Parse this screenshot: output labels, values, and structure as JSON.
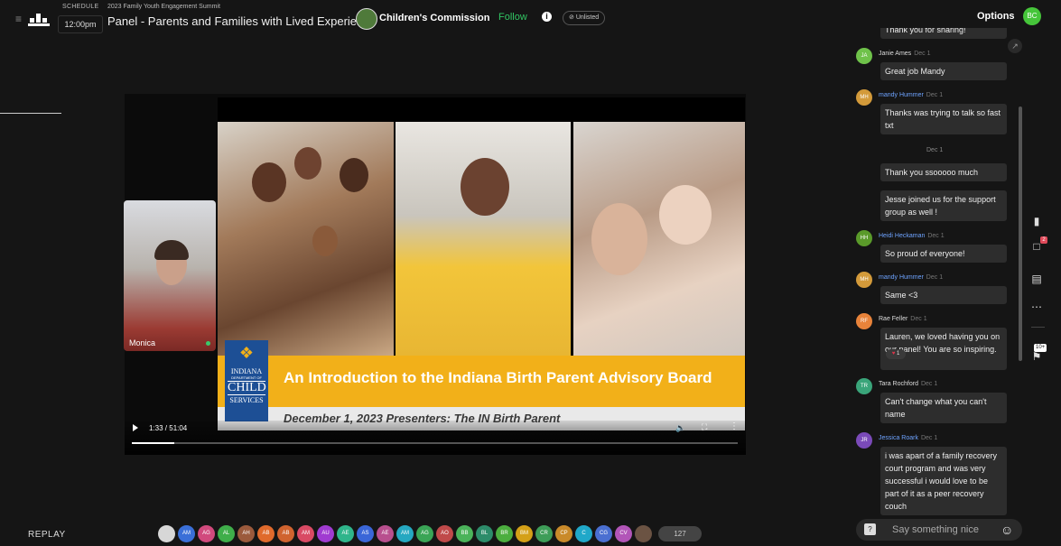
{
  "topbar": {
    "schedule_label": "SCHEDULE",
    "schedule_time": "12:00pm",
    "event_name": "2023 Family Youth Engagement Summit",
    "session_title": "Panel - Parents and Families with Lived Experience",
    "org_name": "Children's Commission",
    "follow_label": "Follow",
    "unlisted_label": "Unlisted",
    "options_label": "Options",
    "user_initials": "BC"
  },
  "slide": {
    "logo_lines": [
      "INDIANA",
      "DEPARTMENT OF",
      "CHILD",
      "SERVICES"
    ],
    "title": "An Introduction to the Indiana Birth Parent Advisory Board",
    "subtitle": "December 1, 2023 Presenters: The IN Birth Parent"
  },
  "video": {
    "time": "1:33 / 51:04",
    "progress": 0.07
  },
  "camera": {
    "name": "Monica"
  },
  "footer": {
    "replay_label": "REPLAY",
    "attendees": [
      {
        "initials": "",
        "color": "#d7d7d7"
      },
      {
        "initials": "AM",
        "color": "#3a6fd8"
      },
      {
        "initials": "AG",
        "color": "#d14a7d"
      },
      {
        "initials": "AL",
        "color": "#3fae4a"
      },
      {
        "initials": "AH",
        "color": "#9b5a3c"
      },
      {
        "initials": "AB",
        "color": "#e06a2c"
      },
      {
        "initials": "AB",
        "color": "#d0632f"
      },
      {
        "initials": "AM",
        "color": "#d94a64"
      },
      {
        "initials": "AU",
        "color": "#a03bd1"
      },
      {
        "initials": "AE",
        "color": "#2fb58b"
      },
      {
        "initials": "AS",
        "color": "#3a66d8"
      },
      {
        "initials": "AE",
        "color": "#b84f8e"
      },
      {
        "initials": "AM",
        "color": "#25a8c1"
      },
      {
        "initials": "AG",
        "color": "#3aa556"
      },
      {
        "initials": "AO",
        "color": "#c04a4a"
      },
      {
        "initials": "BB",
        "color": "#4bb35a"
      },
      {
        "initials": "BL",
        "color": "#2d8c6a"
      },
      {
        "initials": "BR",
        "color": "#4cae3f"
      },
      {
        "initials": "BM",
        "color": "#d4a017"
      },
      {
        "initials": "CR",
        "color": "#3e9d58"
      },
      {
        "initials": "CP",
        "color": "#c98a2a"
      },
      {
        "initials": "C",
        "color": "#20a8c9"
      },
      {
        "initials": "CG",
        "color": "#4a6fd1"
      },
      {
        "initials": "CV",
        "color": "#b255b8"
      },
      {
        "initials": "",
        "color": "#6b5343"
      }
    ],
    "attendee_count": "127"
  },
  "chat": {
    "partial_message": "Thank you for sharing!",
    "messages": [
      {
        "initials": "JA",
        "avatar_color": "#6fc24a",
        "name": "Janie Ames",
        "name_blue": false,
        "time": "Dec 1",
        "lines": [
          "Great job Mandy"
        ]
      },
      {
        "initials": "MH",
        "avatar_color": "#d39a3a",
        "name": "mandy Hummer",
        "name_blue": true,
        "time": "Dec 1",
        "lines": [
          "Thanks was trying to talk so fast txt"
        ]
      },
      {
        "separator": "Dec 1"
      },
      {
        "lines": [
          "Thank you ssooooo much"
        ]
      },
      {
        "lines": [
          "Jesse joined us for the support group as well !"
        ]
      },
      {
        "initials": "HH",
        "avatar_color": "#5a9a2a",
        "name": "Heidi Heckaman",
        "name_blue": true,
        "time": "Dec 1",
        "lines": [
          "So proud of everyone!"
        ]
      },
      {
        "initials": "MH",
        "avatar_color": "#d39a3a",
        "name": "mandy Hummer",
        "name_blue": true,
        "time": "Dec 1",
        "lines": [
          "Same <3"
        ]
      },
      {
        "initials": "RF",
        "avatar_color": "#e8833a",
        "name": "Rae Feller",
        "name_blue": false,
        "time": "Dec 1",
        "lines": [
          "Lauren, we loved having you on our panel!  You are so inspiring."
        ],
        "reaction": "1"
      },
      {
        "initials": "TR",
        "avatar_color": "#3aa57a",
        "name": "Tara Rochford",
        "name_blue": false,
        "time": "Dec 1",
        "lines": [
          "Can't change what you can't name"
        ]
      },
      {
        "initials": "JR",
        "avatar_color": "#7a4ab8",
        "name": "Jessica Roark",
        "name_blue": true,
        "time": "Dec 1",
        "lines": [
          "i was apart of a family recovery court program and was very successful i would love to be part of it as a peer recovery couch"
        ]
      }
    ],
    "input_placeholder": "Say something nice"
  },
  "rail": {
    "qa_badge": "2",
    "polls_badge": "10+"
  }
}
